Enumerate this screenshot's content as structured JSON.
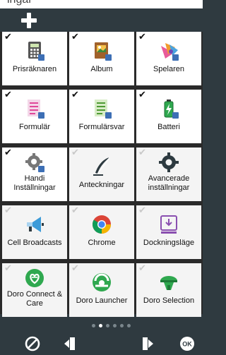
{
  "top_strip_text": "ingar",
  "header": {
    "add_icon": "plus-icon"
  },
  "tiles": [
    {
      "label": "Prisräknaren",
      "checked": true,
      "icon": "calculator-icon"
    },
    {
      "label": "Album",
      "checked": true,
      "icon": "photo-album-icon"
    },
    {
      "label": "Spelaren",
      "checked": true,
      "icon": "music-player-icon"
    },
    {
      "label": "Formulär",
      "checked": true,
      "icon": "form-icon"
    },
    {
      "label": "Formulärsvar",
      "checked": true,
      "icon": "form-answers-icon"
    },
    {
      "label": "Batteri",
      "checked": true,
      "icon": "battery-icon"
    },
    {
      "label_line1": "Handi",
      "label_line2": "Inställningar",
      "checked": true,
      "icon": "settings-gear-icon"
    },
    {
      "label": "Anteckningar",
      "checked": false,
      "icon": "quill-pen-icon"
    },
    {
      "label_line1": "Avancerade",
      "label_line2": "inställningar",
      "checked": false,
      "icon": "advanced-gear-icon"
    },
    {
      "label": "Cell Broadcasts",
      "checked": false,
      "icon": "megaphone-icon"
    },
    {
      "label": "Chrome",
      "checked": false,
      "icon": "chrome-icon"
    },
    {
      "label": "Dockningsläge",
      "checked": false,
      "icon": "docking-icon"
    },
    {
      "label_line1": "Doro Connect &",
      "label_line2": "Care",
      "checked": false,
      "icon": "doro-connect-icon"
    },
    {
      "label": "Doro Launcher",
      "checked": false,
      "icon": "doro-launcher-icon"
    },
    {
      "label": "Doro Selection",
      "checked": false,
      "icon": "doro-selection-icon"
    }
  ],
  "pager": {
    "page_count": 6,
    "current_page": 2
  },
  "bottom_bar": {
    "icons": [
      "no-entry-icon",
      "move-left-icon",
      "move-right-icon",
      "ok-icon"
    ],
    "ok_label": "OK"
  },
  "colors": {
    "background": "#2f3a40",
    "tile": "#ffffff",
    "accent_green": "#2fa84f"
  }
}
